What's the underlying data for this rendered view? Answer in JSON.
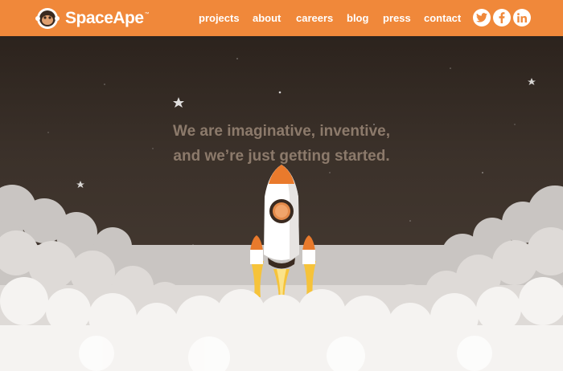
{
  "brand": {
    "name": "SpaceApe",
    "trademark": "™"
  },
  "nav": {
    "projects": "projects",
    "about": "about",
    "careers": "careers",
    "blog": "blog",
    "press": "press",
    "contact": "contact"
  },
  "social": {
    "twitter": "twitter-icon",
    "facebook": "facebook-icon",
    "linkedin": "linkedin-icon"
  },
  "hero": {
    "tagline_line1": "We are imaginative, inventive,",
    "tagline_line2": "and we’re just getting started."
  },
  "colors": {
    "brand_orange": "#f0883a",
    "sky_top": "#2c231d",
    "sky_bottom": "#4a3e35",
    "tagline": "#8c7a6b",
    "cloud_light": "#f5f3f1",
    "cloud_shadow": "#c7c3c0"
  }
}
